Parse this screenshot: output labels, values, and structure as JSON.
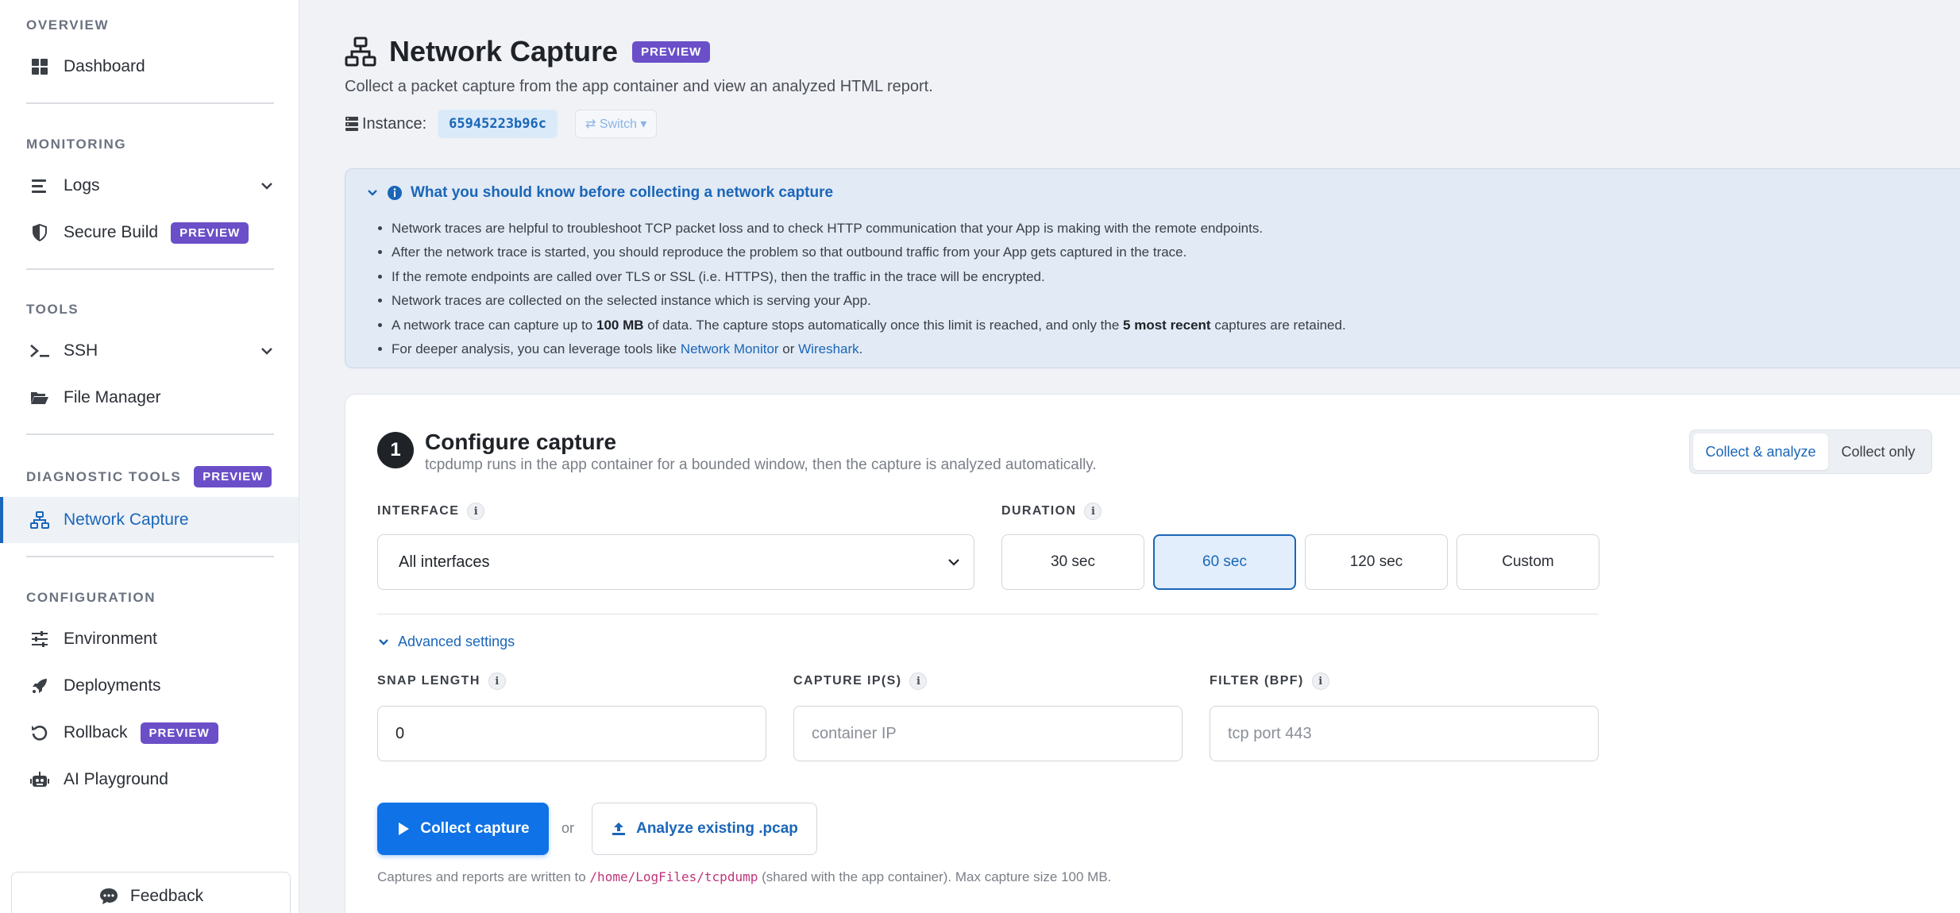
{
  "sidebar": {
    "sections": {
      "overview": "OVERVIEW",
      "monitoring": "MONITORING",
      "tools": "TOOLS",
      "diagnostic": "DIAGNOSTIC TOOLS",
      "configuration": "CONFIGURATION"
    },
    "items": {
      "dashboard": "Dashboard",
      "logs": "Logs",
      "secure_build": "Secure Build",
      "ssh": "SSH",
      "file_manager": "File Manager",
      "network_capture": "Network Capture",
      "environment": "Environment",
      "deployments": "Deployments",
      "rollback": "Rollback",
      "ai_playground": "AI Playground"
    },
    "preview_badge": "PREVIEW",
    "feedback": "Feedback",
    "active_color": "#1a66b8"
  },
  "header": {
    "title": "Network Capture",
    "badge": "PREVIEW",
    "subtitle": "Collect a packet capture from the app container and view an analyzed HTML report.",
    "instance_label": "Instance:",
    "instance_id": "65945223b96c",
    "switch_label": "⇄ Switch ▾"
  },
  "info": {
    "title": "What you should know before collecting a network capture",
    "items": [
      "Network traces are helpful to troubleshoot TCP packet loss and to check HTTP communication that your App is making with the remote endpoints.",
      "After the network trace is started, you should reproduce the problem so that outbound traffic from your App gets captured in the trace.",
      "If the remote endpoints are called over TLS or SSL (i.e. HTTPS), then the traffic in the trace will be encrypted.",
      "Network traces are collected on the selected instance which is serving your App."
    ],
    "limit": {
      "p1": "A network trace can capture up to ",
      "b1": "100 MB",
      "p2": " of data. The capture stops automatically once this limit is reached, and only the ",
      "b2": "5 most recent",
      "p3": " captures are retained."
    },
    "tools": {
      "p1": "For deeper analysis, you can leverage tools like ",
      "link1": "Network Monitor",
      "p2": " or ",
      "link2": "Wireshark",
      "p3": "."
    }
  },
  "config": {
    "step": "1",
    "title": "Configure capture",
    "subtitle": "tcpdump runs in the app container for a bounded window, then the capture is analyzed automatically.",
    "mode_selected": "Collect & analyze",
    "mode_other": "Collect only",
    "interface_label": "INTERFACE",
    "interface_value": "All interfaces",
    "duration_label": "DURATION",
    "durations": [
      "30 sec",
      "60 sec",
      "120 sec",
      "Custom"
    ],
    "duration_selected": "60 sec",
    "advanced": "Advanced settings",
    "snap_label": "SNAP LENGTH",
    "snap_value": "0",
    "ip_label": "CAPTURE IP(S)",
    "ip_placeholder": "container IP",
    "filter_label": "FILTER (BPF)",
    "filter_placeholder": "tcp port 443",
    "collect_button": "Collect capture",
    "or": "or",
    "analyze_button": "Analyze existing .pcap",
    "note_pre": "Captures and reports are written to ",
    "note_path": "/home/LogFiles/tcpdump",
    "note_post": " (shared with the app container). Max capture size 100 MB."
  }
}
